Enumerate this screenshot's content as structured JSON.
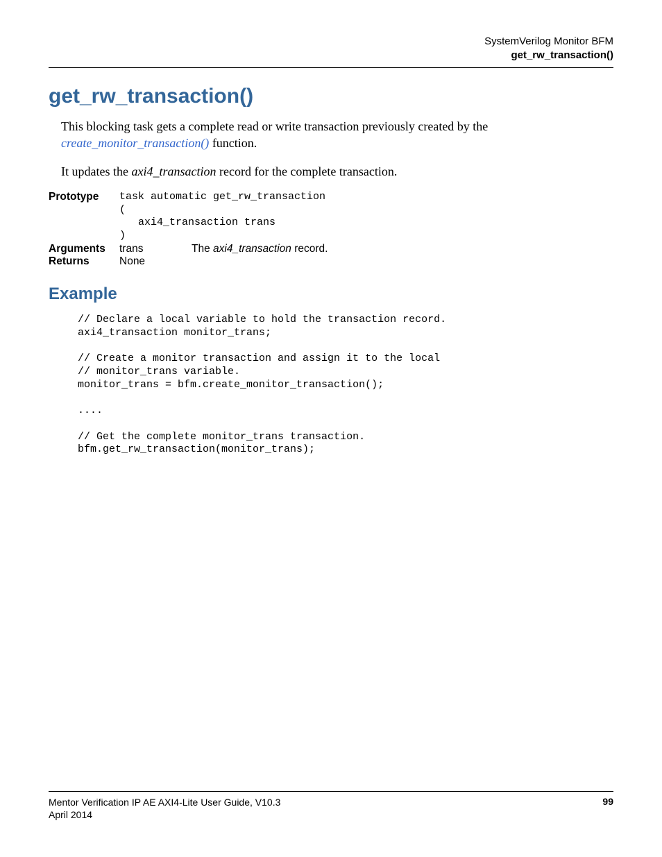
{
  "header": {
    "line1": "SystemVerilog Monitor BFM",
    "line2": "get_rw_transaction()"
  },
  "title": "get_rw_transaction()",
  "intro": {
    "part1": "This blocking task gets a complete read or write transaction previously created by the ",
    "link": "create_monitor_transaction()",
    "part2": " function."
  },
  "para2": {
    "pre": "It updates the ",
    "italic": "axi4_transaction",
    "post": " record for the complete transaction."
  },
  "defs": {
    "prototype_label": "Prototype",
    "prototype_code": "task automatic get_rw_transaction\n(\n   axi4_transaction trans\n)",
    "arguments_label": "Arguments",
    "arguments_name": "trans",
    "arguments_desc_pre": "The ",
    "arguments_desc_italic": "axi4_transaction",
    "arguments_desc_post": " record.",
    "returns_label": "Returns",
    "returns_value": "None"
  },
  "example_heading": "Example",
  "example_code": "// Declare a local variable to hold the transaction record.\naxi4_transaction monitor_trans;\n\n// Create a monitor transaction and assign it to the local\n// monitor_trans variable.\nmonitor_trans = bfm.create_monitor_transaction();\n\n....\n\n// Get the complete monitor_trans transaction.\nbfm.get_rw_transaction(monitor_trans);",
  "footer": {
    "guide": "Mentor Verification IP AE AXI4-Lite User Guide, V10.3",
    "date": "April 2014",
    "page": "99"
  }
}
